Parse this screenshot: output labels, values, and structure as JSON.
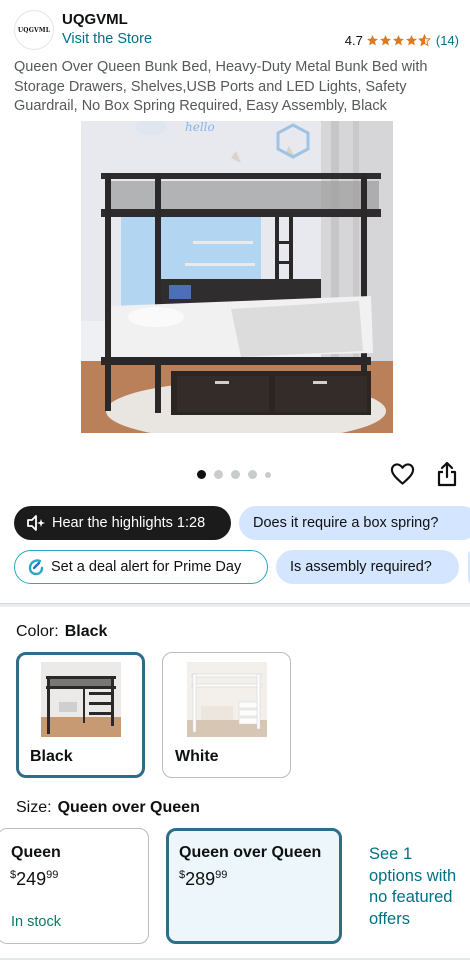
{
  "store": {
    "logo_text": "UQGVML",
    "name": "UQGVML",
    "visit_link": "Visit the Store",
    "rating_value": "4.7",
    "rating_stars": 4.7,
    "rating_count": "(14)"
  },
  "product": {
    "title": "Queen Over Queen Bunk Bed, Heavy-Duty Metal Bunk Bed with Storage Drawers, Shelves,USB Ports and LED Lights, Safety Guardrail, No Box Spring Required, Easy Assembly, Black",
    "image_icon": "bunk-bed-photo",
    "carousel_total_dots": 5,
    "carousel_active_index": 0
  },
  "actions": {
    "wishlist_icon": "heart-icon",
    "share_icon": "share-icon"
  },
  "chips": {
    "highlights": "Hear the highlights 1:28",
    "question_box_spring": "Does it require a box spring?",
    "deal_alert": "Set a deal alert for Prime Day",
    "question_assembly": "Is assembly required?"
  },
  "color": {
    "label": "Color:",
    "selected": "Black",
    "options": [
      {
        "name": "Black",
        "selected": true
      },
      {
        "name": "White",
        "selected": false
      }
    ]
  },
  "size": {
    "label": "Size:",
    "selected": "Queen over Queen",
    "options": [
      {
        "name": "Queen",
        "currency": "$",
        "whole": "249",
        "fraction": "99",
        "stock": "In stock",
        "selected": false
      },
      {
        "name": "Queen over Queen",
        "currency": "$",
        "whole": "289",
        "fraction": "99",
        "selected": true
      }
    ],
    "see_options": "See 1 options with no featured offers"
  },
  "colors": {
    "link": "#007185",
    "stock_green": "#067d62",
    "selected_border": "#2e6d8a",
    "chip_blue": "#d4e6ff",
    "star_orange": "#de7921"
  }
}
